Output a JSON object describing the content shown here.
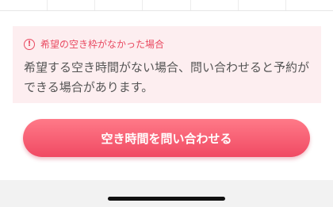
{
  "notice": {
    "icon": "alert-circle-icon",
    "icon_glyph": "!",
    "title": "希望の空き枠がなかった場合",
    "body": "希望する空き時間がない場合、問い合わせると予約ができる場合があります。"
  },
  "cta": {
    "label": "空き時間を問い合わせる"
  },
  "colors": {
    "accent": "#e94a61",
    "notice_bg": "#fdeef0",
    "button_top": "#ff7a88",
    "button_bottom": "#f04a63",
    "body_text": "#555555",
    "bottom_bar": "#f2f2f2"
  }
}
